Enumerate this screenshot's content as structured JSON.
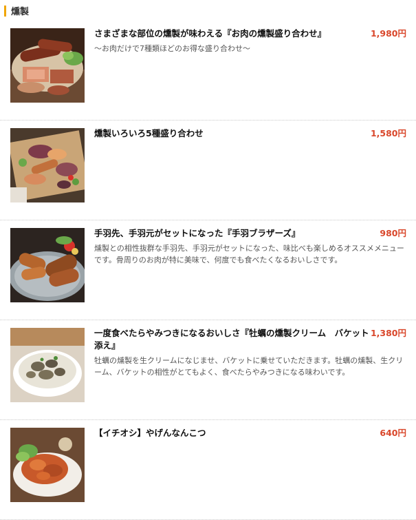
{
  "section": {
    "title": "燻製"
  },
  "items": [
    {
      "name": "さまざまな部位の燻製が味わえる『お肉の燻製盛り合わせ』",
      "price": "1,980円",
      "description": "～お肉だけで7種類ほどのお得な盛り合わせ～",
      "photo_icon": "smoked-meat-platter-photo"
    },
    {
      "name": "燻製いろいろ5種盛り合わせ",
      "price": "1,580円",
      "description": "",
      "photo_icon": "smoked-assortment-photo"
    },
    {
      "name": "手羽先、手羽元がセットになった『手羽ブラザーズ』",
      "price": "980円",
      "description": "燻製との相性抜群な手羽先、手羽元がセットになった、味比べも楽しめるオススメメニューです。骨周りのお肉が特に美味で、何度でも食べたくなるおいしさです。",
      "photo_icon": "chicken-wings-photo"
    },
    {
      "name": "一度食べたらやみつきになるおいしさ『牡蠣の燻製クリーム　バケット添え』",
      "price": "1,380円",
      "description": "牡蠣の燻製を生クリームになじませ、バケットに乗せていただきます。牡蠣の燻製、生クリーム、バケットの相性がとてもよく、食べたらやみつきになる味わいです。",
      "photo_icon": "oyster-cream-photo"
    },
    {
      "name": "【イチオシ】やげんなんこつ",
      "price": "640円",
      "description": "",
      "photo_icon": "cartilage-photo"
    }
  ]
}
